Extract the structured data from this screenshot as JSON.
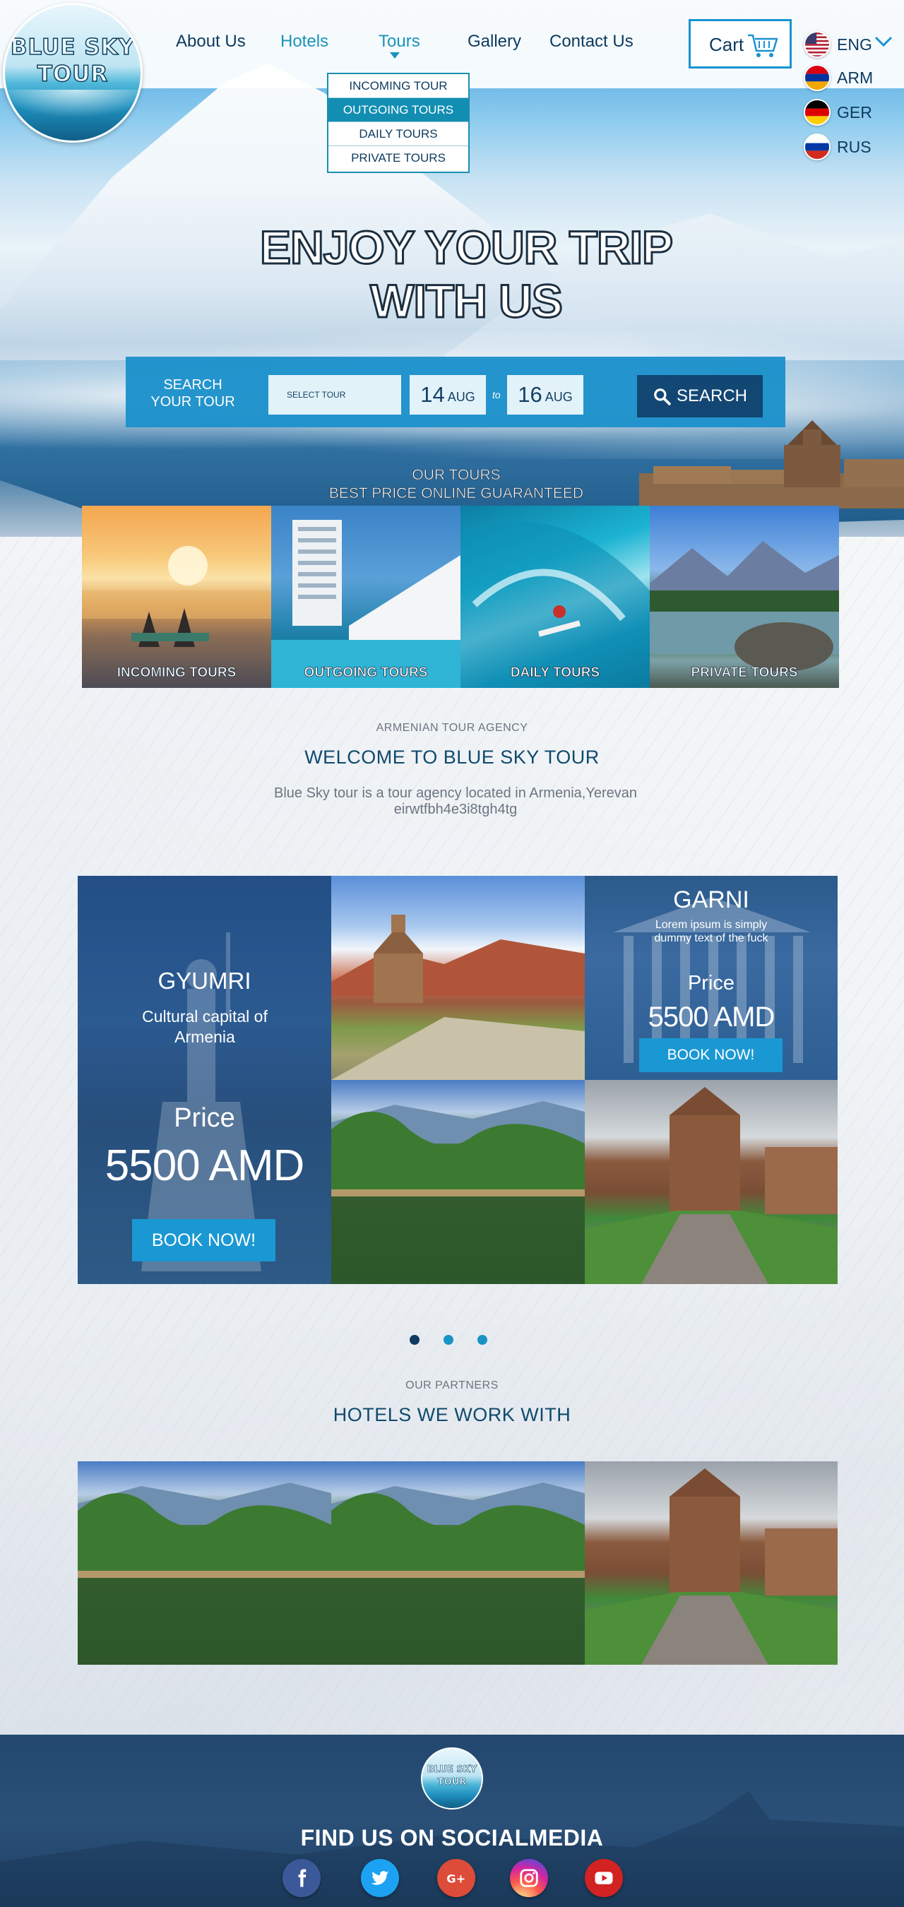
{
  "logo": {
    "line1": "BLUE SKY",
    "line2": "TOUR"
  },
  "nav": {
    "about": "About Us",
    "hotels": "Hotels",
    "tours": "Tours",
    "gallery": "Gallery",
    "contact": "Contact Us"
  },
  "tours_dropdown": {
    "items": [
      "INCOMING TOUR",
      "OUTGOING TOURS",
      "DAILY TOURS",
      "PRIVATE TOURS"
    ],
    "highlighted": "OUTGOING TOURS"
  },
  "cart": {
    "label": "Cart"
  },
  "languages": [
    {
      "code": "ENG",
      "flag": "us-flag-icon"
    },
    {
      "code": "ARM",
      "flag": "armenia-flag-icon"
    },
    {
      "code": "GER",
      "flag": "germany-flag-icon"
    },
    {
      "code": "RUS",
      "flag": "russia-flag-icon"
    }
  ],
  "hero": {
    "title_line1": "ENJOY YOUR TRIP",
    "title_line2": "WITH US"
  },
  "search": {
    "label": "SEARCH YOUR TOUR",
    "select_placeholder": "SELECT TOUR",
    "from_day": "14",
    "from_month": "AUG",
    "to_word": "to",
    "to_day": "16",
    "to_month": "AUG",
    "button": "SEARCH"
  },
  "our_tours": {
    "heading_line1": "OUR TOURS",
    "heading_line2": "BEST PRICE ONLINE GUARANTEED",
    "cards": [
      "INCOMING TOURS",
      "OUTGOING TOURS",
      "DAILY TOURS",
      "PRIVATE TOURS"
    ]
  },
  "welcome": {
    "kicker": "ARMENIAN TOUR AGENCY",
    "title": "WELCOME TO BLUE SKY TOUR",
    "desc_line1": "Blue Sky tour is a tour agency located in Armenia,Yerevan",
    "desc_line2": "eirwtfbh4e3i8tgh4tg"
  },
  "slider": {
    "gyumri": {
      "title": "GYUMRI",
      "subtitle": "Cultural capital of Armenia",
      "price_label": "Price",
      "price": "5500 AMD",
      "button": "BOOK NOW!"
    },
    "garni": {
      "title": "GARNI",
      "desc": "Lorem ipsum is simply dummy text of the fuck",
      "price_label": "Price",
      "price": "5500 AMD",
      "button": "BOOK NOW!"
    },
    "active_dot": 1,
    "dot_count": 3
  },
  "partners": {
    "kicker": "OUR PARTNERS",
    "title": "HOTELS WE WORK WITH"
  },
  "footer": {
    "logo_line1": "BLUE SKY",
    "logo_line2": "TOUR",
    "title": "FIND US ON SOCIALMEDIA",
    "socials": [
      "facebook-icon",
      "twitter-icon",
      "google-plus-icon",
      "instagram-icon",
      "youtube-icon"
    ]
  },
  "colors": {
    "primary_dark": "#0d3a5e",
    "accent": "#1a93c4",
    "button": "#1a98d3",
    "search_bar": "#1e92cc",
    "footer": "#23486f"
  }
}
